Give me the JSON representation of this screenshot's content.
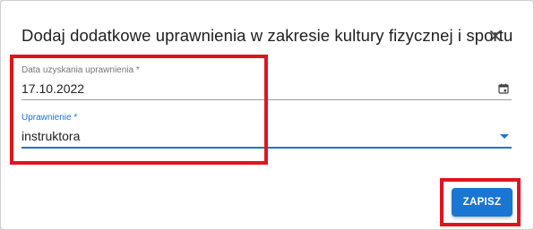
{
  "dialog": {
    "title": "Dodaj dodatkowe uprawnienia w zakresie kultury fizycznej i sportu",
    "close_icon": "close-icon"
  },
  "form": {
    "date_field": {
      "label": "Data uzyskania uprawnienia *",
      "value": "17.10.2022",
      "icon": "calendar-icon"
    },
    "permission_field": {
      "label": "Uprawnienie *",
      "value": "instruktora",
      "icon": "chevron-down-icon"
    }
  },
  "actions": {
    "save_label": "ZAPISZ"
  },
  "colors": {
    "accent": "#1976d2",
    "highlight": "#e0141e"
  }
}
